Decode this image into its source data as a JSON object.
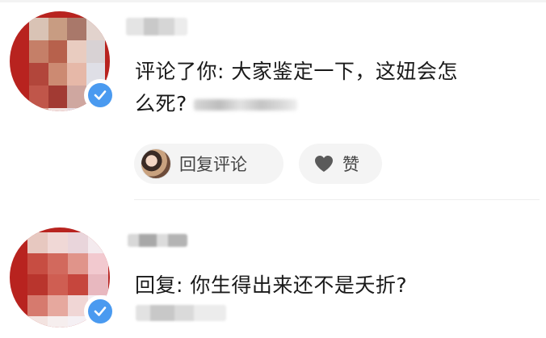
{
  "comment1": {
    "text_line1": "评论了你: 大家鉴定一下，这妞会怎",
    "text_line2": "么死?",
    "reply_button_label": "回复评论",
    "like_button_label": "赞"
  },
  "comment2": {
    "text": "回复: 你生得出来还不是夭折?"
  },
  "colors": {
    "avatar_red": "#b8231f",
    "verified_blue": "#4a9af0",
    "pill_bg": "#f4f4f4",
    "text": "#1a1a1a"
  },
  "icons": {
    "verified": "verified-badge-icon",
    "heart": "heart-icon",
    "replier_avatar": "avatar"
  }
}
